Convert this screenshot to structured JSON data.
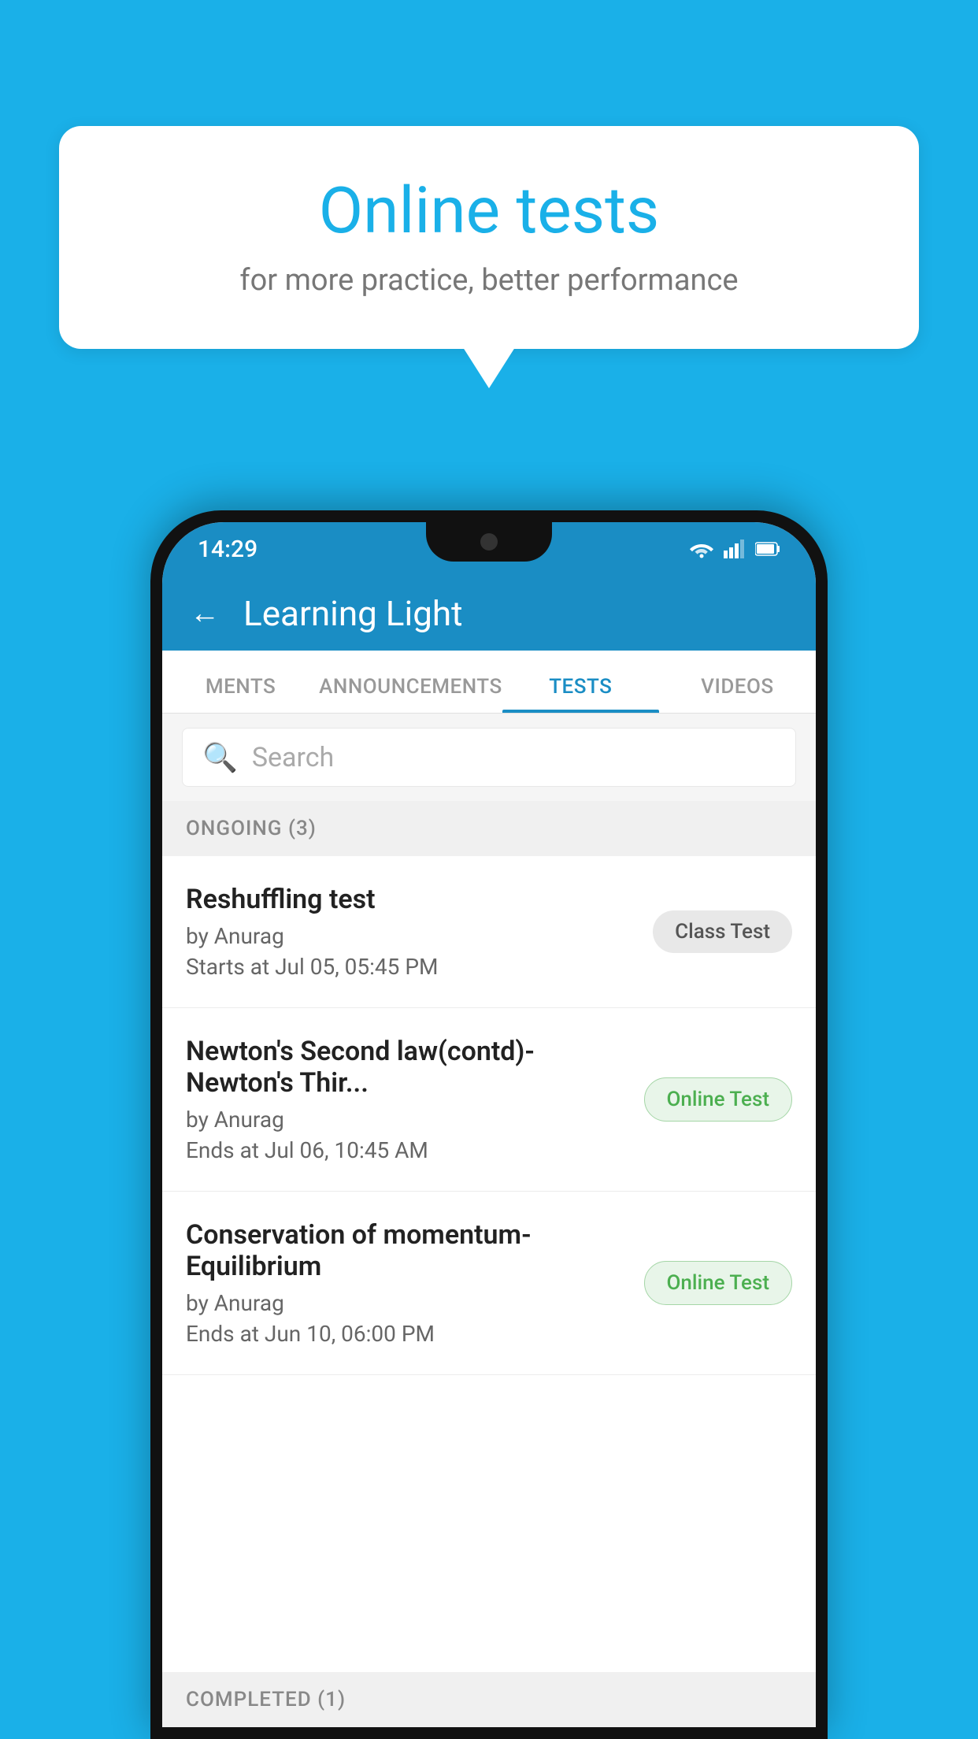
{
  "background": {
    "color": "#1ab0e8"
  },
  "speech_bubble": {
    "title": "Online tests",
    "subtitle": "for more practice, better performance"
  },
  "phone": {
    "status_bar": {
      "time": "14:29"
    },
    "header": {
      "title": "Learning Light",
      "back_label": "←"
    },
    "tabs": [
      {
        "label": "MENTS",
        "active": false
      },
      {
        "label": "ANNOUNCEMENTS",
        "active": false
      },
      {
        "label": "TESTS",
        "active": true
      },
      {
        "label": "VIDEOS",
        "active": false
      }
    ],
    "search": {
      "placeholder": "Search"
    },
    "sections": [
      {
        "label": "ONGOING (3)",
        "items": [
          {
            "name": "Reshuffling test",
            "author": "by Anurag",
            "date_label": "Starts at",
            "date": "Jul 05, 05:45 PM",
            "badge": "Class Test",
            "badge_type": "class"
          },
          {
            "name": "Newton's Second law(contd)-Newton's Thir...",
            "author": "by Anurag",
            "date_label": "Ends at",
            "date": "Jul 06, 10:45 AM",
            "badge": "Online Test",
            "badge_type": "online"
          },
          {
            "name": "Conservation of momentum-Equilibrium",
            "author": "by Anurag",
            "date_label": "Ends at",
            "date": "Jun 10, 06:00 PM",
            "badge": "Online Test",
            "badge_type": "online"
          }
        ]
      }
    ],
    "completed_section_label": "COMPLETED (1)"
  }
}
